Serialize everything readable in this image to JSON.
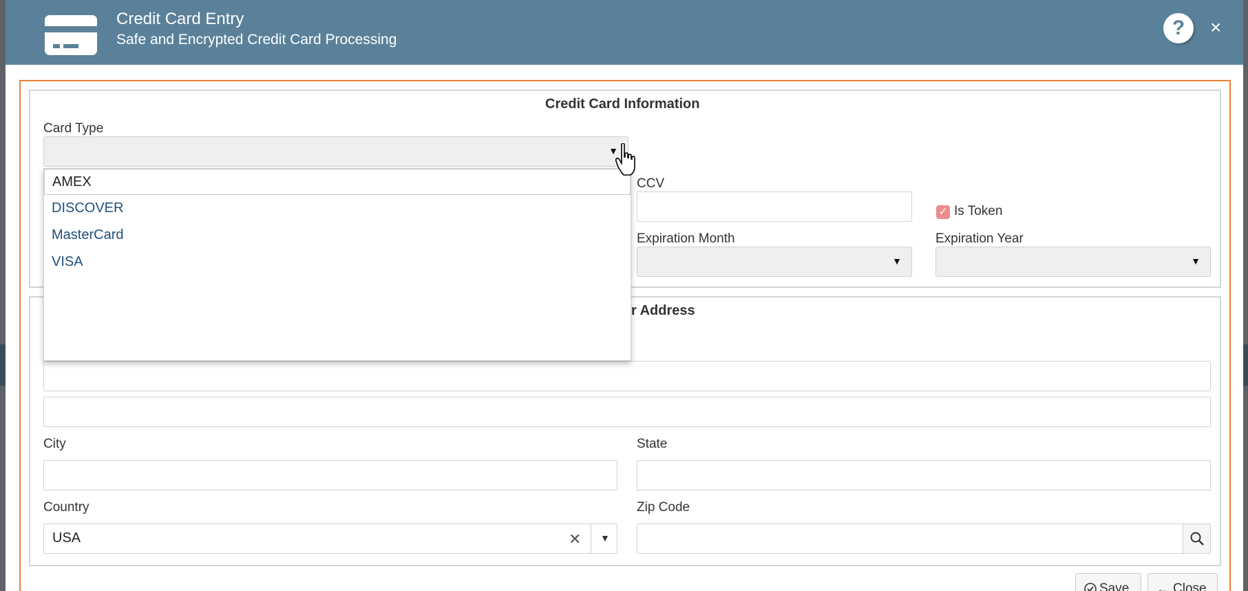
{
  "header": {
    "title": "Credit Card Entry",
    "subtitle": "Safe and Encrypted Credit Card Processing",
    "help_label": "?",
    "close_label": "×"
  },
  "card_info": {
    "section_title": "Credit Card Information",
    "card_type_label": "Card Type",
    "card_type_value": "",
    "card_type_options": [
      "AMEX",
      "DISCOVER",
      "MasterCard",
      "VISA"
    ],
    "ccv_label": "CCV",
    "is_token_label": "Is Token",
    "is_token_checked": true,
    "exp_month_label": "Expiration Month",
    "exp_year_label": "Expiration Year"
  },
  "address": {
    "section_title_visible": "r Address",
    "city_label": "City",
    "state_label": "State",
    "country_label": "Country",
    "country_value": "USA",
    "zip_label": "Zip Code"
  },
  "footer": {
    "save_label": "Save",
    "close_label": "Close"
  },
  "colors": {
    "header_bg": "#5a8199",
    "frame_accent": "#ef7f33",
    "checkbox": "#ea8d8d",
    "option_text": "#1f4f7a"
  },
  "icons": [
    "credit-card-icon",
    "help-icon",
    "close-icon",
    "chevron-down-icon",
    "clear-icon",
    "search-icon",
    "check-circle-icon",
    "arrow-left-icon",
    "hand-cursor-icon"
  ]
}
